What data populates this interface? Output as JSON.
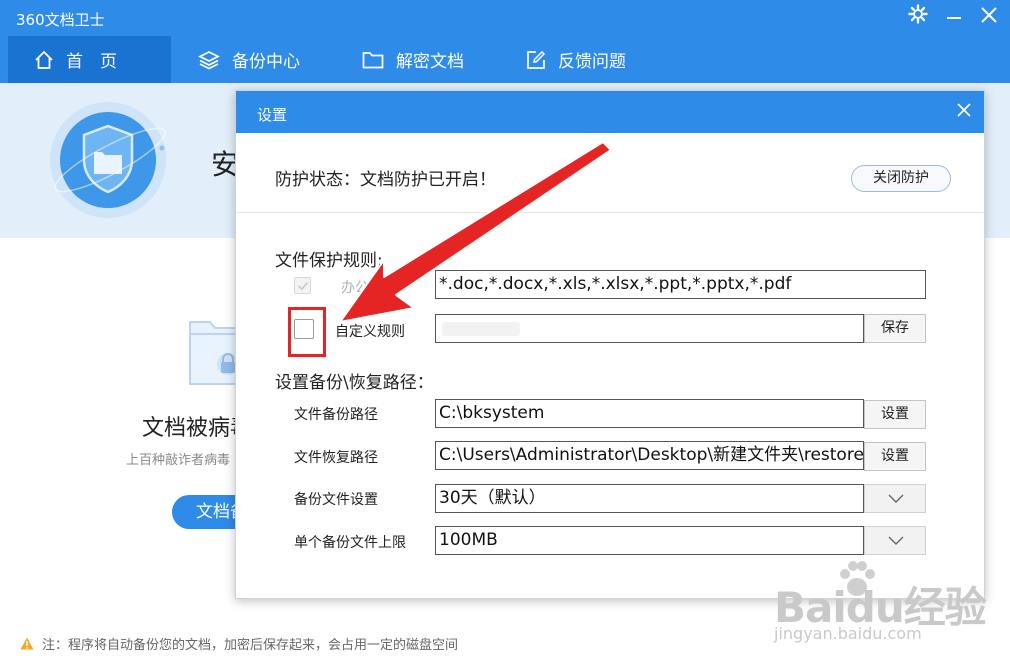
{
  "app": {
    "title": "360文档卫士"
  },
  "nav": {
    "tabs": [
      {
        "label": "首　页",
        "icon": "home-icon"
      },
      {
        "label": "备份中心",
        "icon": "layers-icon"
      },
      {
        "label": "解密文档",
        "icon": "folder-icon"
      },
      {
        "label": "反馈问题",
        "icon": "edit-icon"
      }
    ],
    "active_index": 0
  },
  "home": {
    "hero_text": "安",
    "virus_heading": "文档被病毒",
    "virus_sub": "上百种敲诈者病毒",
    "doc_button": "文档备",
    "footer_note": "注：程序将自动备份您的文档，加密后保存起来，会占用一定的磁盘空间"
  },
  "dialog": {
    "title": "设置",
    "status_text": "防护状态：文档防护已开启！",
    "close_protect_label": "关闭防护",
    "rules_label": "文件保护规则:",
    "office_rule": {
      "label": "办公",
      "checked": true,
      "disabled": true,
      "value": "*.doc,*.docx,*.xls,*.xlsx,*.ppt,*.pptx,*.pdf"
    },
    "custom_rule": {
      "label": "自定义规则",
      "checked": false,
      "value": ""
    },
    "save_label": "保存",
    "path_label": "设置备份\\恢复路径：",
    "rows": {
      "backup_path": {
        "label": "文件备份路径",
        "value": "C:\\bksystem",
        "button": "设置"
      },
      "restore_path": {
        "label": "文件恢复路径",
        "value": "C:\\Users\\Administrator\\Desktop\\新建文件夹\\restore",
        "button": "设置"
      },
      "backup_setting": {
        "label": "备份文件设置",
        "value": "30天（默认）"
      },
      "size_limit": {
        "label": "单个备份文件上限",
        "value": "100MB"
      }
    }
  },
  "watermark": {
    "logo": "Baidu经验",
    "url": "jingyan.baidu.com"
  },
  "colors": {
    "brand_blue": "#2e8be8",
    "nav_active": "#1b73d1",
    "hero_bg": "#e2effb",
    "annotation_red": "#e52424"
  }
}
